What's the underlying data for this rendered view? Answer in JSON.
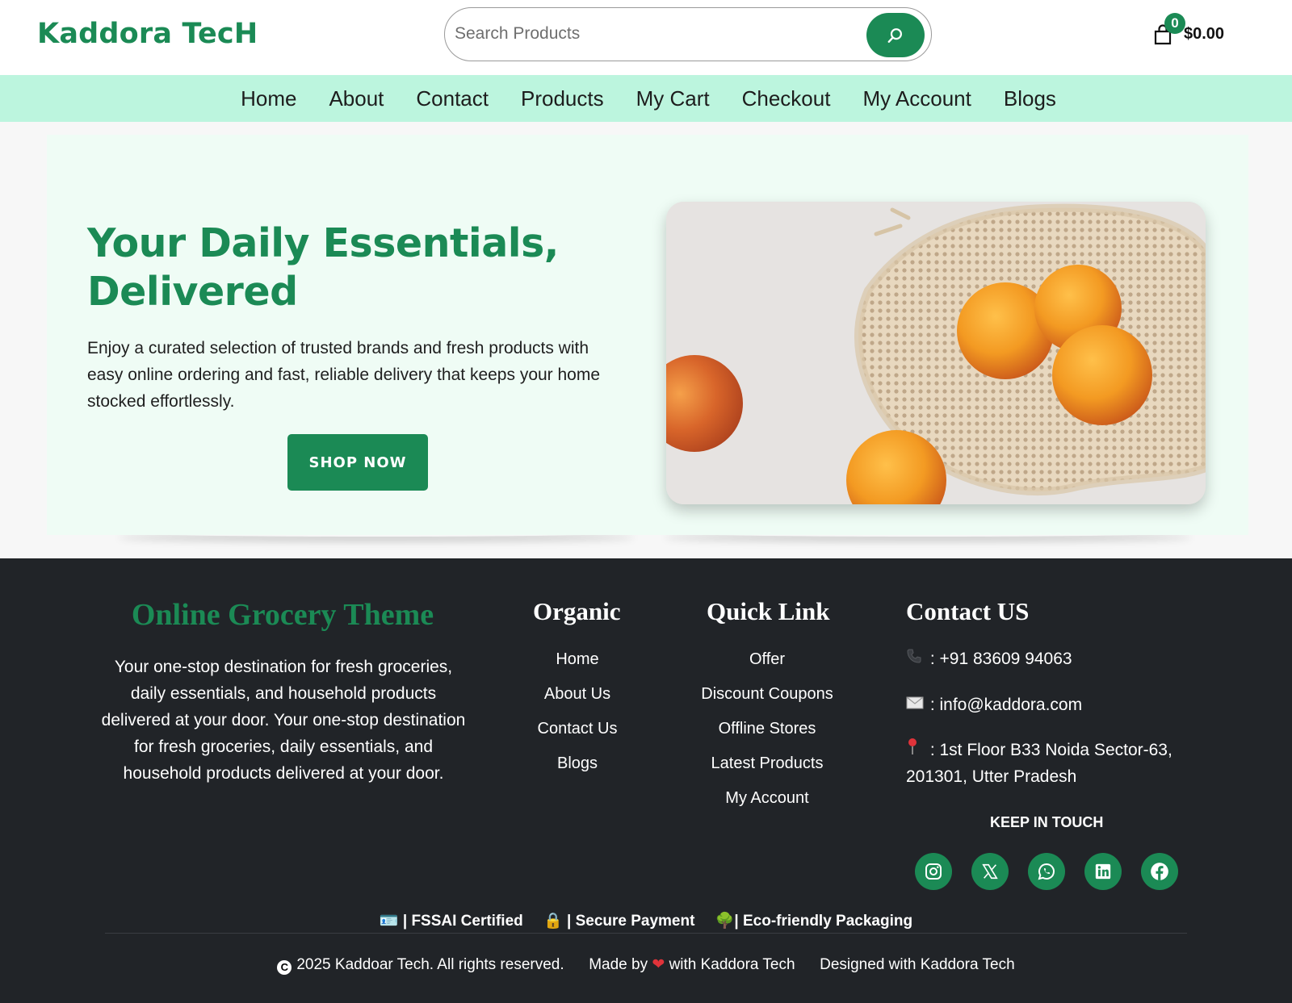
{
  "header": {
    "logo": "Kaddora TecH",
    "search_placeholder": "Search Products",
    "cart_count": "0",
    "cart_total": "$0.00"
  },
  "nav": {
    "items": [
      "Home",
      "About",
      "Contact",
      "Products",
      "My Cart",
      "Checkout",
      "My Account",
      "Blogs"
    ]
  },
  "hero": {
    "title_line1": "Your Daily Essentials,",
    "title_line2": "Delivered",
    "description": "Enjoy a curated selection of trusted brands and fresh products with easy online ordering and fast, reliable delivery that keeps your home stocked effortlessly.",
    "button": "SHOP NOW",
    "image_subject": "apricots-in-mesh-bag"
  },
  "footer": {
    "brand": "Online Grocery Theme",
    "description": "Your one-stop destination for fresh groceries, daily essentials, and household products delivered at your door. Your one-stop destination for fresh groceries, daily essentials, and household products delivered at your door.",
    "organic": {
      "title": "Organic",
      "links": [
        "Home",
        "About Us",
        "Contact Us",
        "Blogs"
      ]
    },
    "quick_link": {
      "title": "Quick Link",
      "links": [
        "Offer",
        "Discount Coupons",
        "Offline Stores",
        "Latest Products",
        "My Account"
      ]
    },
    "contact": {
      "title": "Contact US",
      "phone": " : +91 83609 94063",
      "email": " : info@kaddora.com",
      "address_line1": " : 1st Floor B33 Noida Sector-63,",
      "address_line2": "201301, Utter Pradesh",
      "keep_in_touch": "KEEP IN TOUCH",
      "socials": [
        "instagram-icon",
        "x-icon",
        "whatsapp-icon",
        "linkedin-icon",
        "facebook-icon"
      ]
    },
    "badges": [
      "| FSSAI Certified",
      "| Secure Payment",
      "| Eco-friendly Packaging"
    ],
    "copyright": "2025 Kaddoar Tech. All rights reserved.",
    "made_by_prefix": "Made by",
    "made_by_suffix": "with Kaddora Tech",
    "designed_with": "Designed with Kaddora Tech"
  },
  "colors": {
    "brand_green": "#1b8a55",
    "nav_bg": "#bcf5de",
    "hero_bg": "#effcf5",
    "footer_bg": "#212428"
  }
}
